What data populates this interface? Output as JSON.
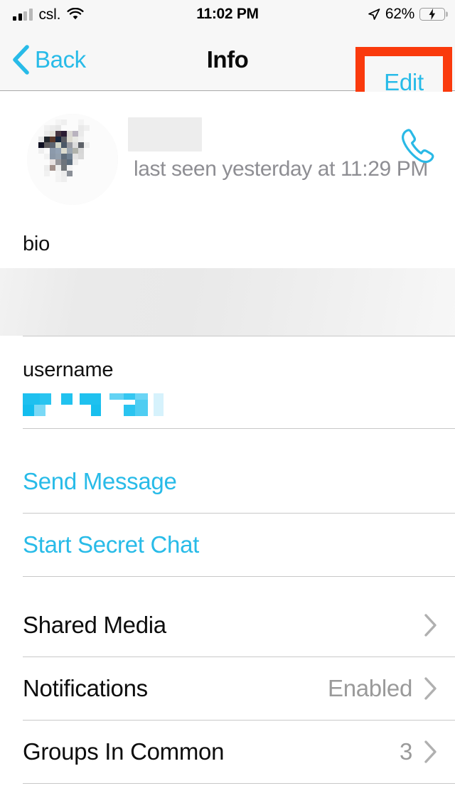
{
  "status_bar": {
    "carrier": "csl.",
    "time": "11:02 PM",
    "battery_percent": "62%",
    "signal_bars_filled": 2,
    "signal_bars_total": 4,
    "wifi_icon": "wifi-icon",
    "location_icon": "location-arrow-icon",
    "battery_icon": "battery-charging-icon",
    "battery_level": 62,
    "charging": true
  },
  "nav_bar": {
    "back_label": "Back",
    "back_icon": "chevron-left-icon",
    "title": "Info",
    "edit_label": "Edit",
    "highlight_color": "#fa3a0d"
  },
  "profile": {
    "avatar_icon": "avatar-pixelated",
    "name_redacted": true,
    "last_seen": "last seen yesterday at 11:29 PM",
    "call_icon": "phone-icon"
  },
  "fields": {
    "bio_label": "bio",
    "bio_redacted": true,
    "username_label": "username",
    "username_redacted": true
  },
  "actions": [
    {
      "label": "Send Message",
      "name": "send-message"
    },
    {
      "label": "Start Secret Chat",
      "name": "start-secret-chat"
    }
  ],
  "list_rows": [
    {
      "label": "Shared Media",
      "value": "",
      "name": "shared-media"
    },
    {
      "label": "Notifications",
      "value": "Enabled",
      "name": "notifications"
    },
    {
      "label": "Groups In Common",
      "value": "3",
      "name": "groups-in-common"
    }
  ],
  "colors": {
    "accent": "#28bbe8",
    "text": "#0d0d0d",
    "muted": "#9a9a9a",
    "bar_bg": "#f7f7f7",
    "separator": "#c8c8c8",
    "battery_green": "#3cd23c"
  }
}
